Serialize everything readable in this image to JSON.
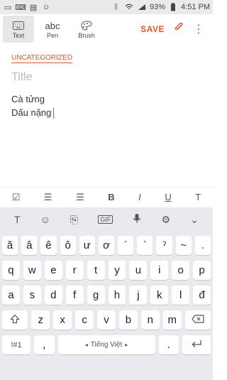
{
  "status": {
    "battery": "93%",
    "time": "4:51 PM"
  },
  "toolbar": {
    "modes": [
      {
        "label": "Text",
        "icon": "keyboard-icon"
      },
      {
        "label": "Pen",
        "icon": "abc",
        "glyph": "abc"
      },
      {
        "label": "Brush",
        "icon": "palette-icon"
      }
    ],
    "save_label": "SAVE"
  },
  "note": {
    "category": "UNCATEGORIZED",
    "title_placeholder": "Title",
    "lines": [
      "Cà tửng",
      "Dấu nặng"
    ]
  },
  "format_bar": {
    "items": [
      "☑",
      "☰",
      "☰",
      "B",
      "I",
      "U",
      "T"
    ]
  },
  "keyboard": {
    "top_icons": [
      "T",
      "☺",
      "⎘",
      "GIF",
      "🎤",
      "⚙",
      "⌄"
    ],
    "row1": [
      "ă",
      "â",
      "ê",
      "ô",
      "ư",
      "ơ",
      "´",
      "`",
      "ˀ",
      "~",
      "."
    ],
    "row2": [
      "q",
      "w",
      "e",
      "r",
      "t",
      "y",
      "u",
      "i",
      "o",
      "p"
    ],
    "row3": [
      "a",
      "s",
      "d",
      "f",
      "g",
      "h",
      "j",
      "k",
      "l",
      "đ"
    ],
    "row4": [
      "z",
      "x",
      "c",
      "v",
      "b",
      "n",
      "m"
    ],
    "bottom": {
      "symbols": "!#1",
      "comma": ",",
      "space": "Tiếng Việt",
      "period": "."
    }
  },
  "colors": {
    "accent": "#e3532c",
    "keyboard_bg": "#e9eaee"
  }
}
